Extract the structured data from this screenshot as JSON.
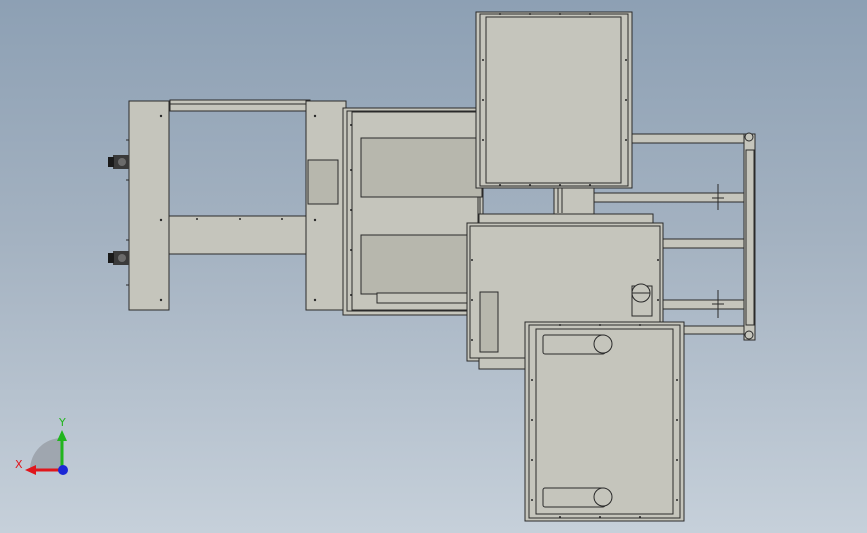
{
  "view": {
    "background_top": "#8da0b4",
    "background_bottom": "#c6d0da",
    "part_fill": "#c5c5bc",
    "part_fill_dark": "#b7b7ad",
    "edge_color": "#2a2a2a"
  },
  "triad": {
    "x_label": "X",
    "y_label": "Y",
    "x_color": "#e0161c",
    "y_color": "#21b51e",
    "z_color": "#1b27d6"
  }
}
